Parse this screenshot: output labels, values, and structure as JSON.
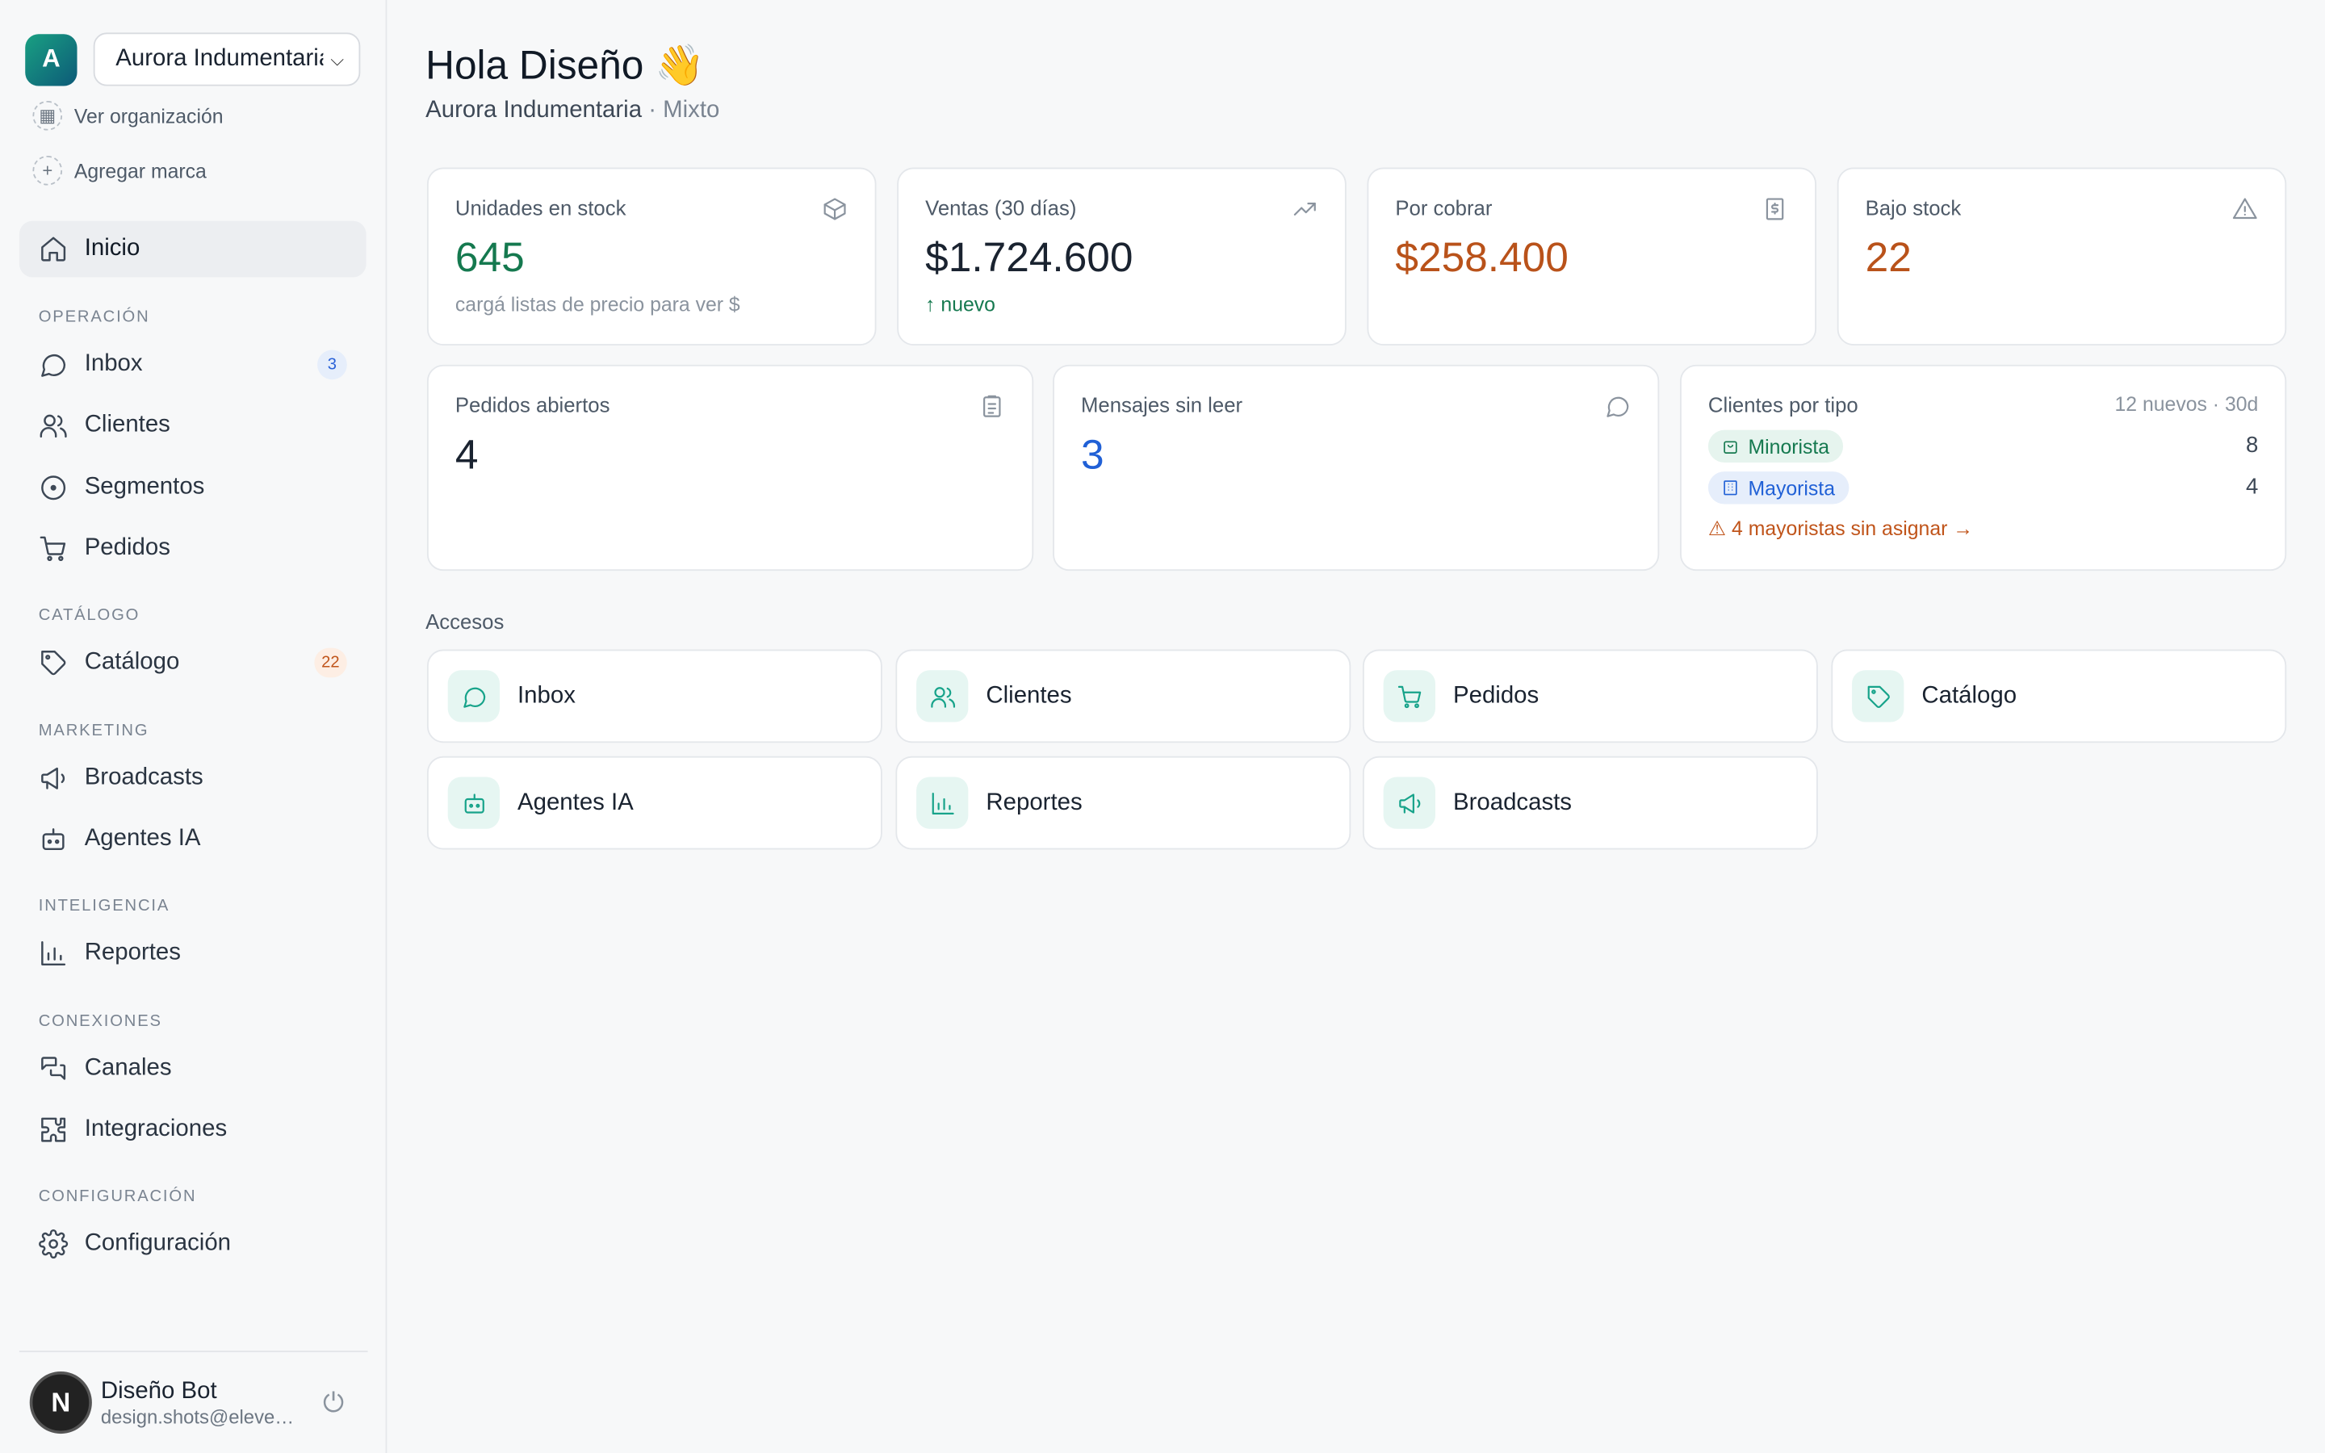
{
  "org": {
    "avatar_letter": "A",
    "selected": "Aurora Indumentaria",
    "view_org": "Ver organización",
    "add_brand": "Agregar marca"
  },
  "nav": {
    "home": "Inicio",
    "sections": {
      "operacion": "OPERACIÓN",
      "catalogo": "CATÁLOGO",
      "marketing": "MARKETING",
      "inteligencia": "INTELIGENCIA",
      "conexiones": "CONEXIONES",
      "configuracion": "CONFIGURACIÓN"
    },
    "inbox": "Inbox",
    "inbox_badge": "3",
    "clientes": "Clientes",
    "segmentos": "Segmentos",
    "pedidos": "Pedidos",
    "catalogo": "Catálogo",
    "catalogo_badge": "22",
    "broadcasts": "Broadcasts",
    "agentes": "Agentes IA",
    "reportes": "Reportes",
    "canales": "Canales",
    "integraciones": "Integraciones",
    "configuracion": "Configuración"
  },
  "user": {
    "avatar_letter": "N",
    "name": "Diseño Bot",
    "email": "design.shots@eleven.studio"
  },
  "header": {
    "greeting": "Hola Diseño 👋",
    "org_name": "Aurora Indumentaria",
    "org_type": "· Mixto"
  },
  "stats": {
    "stock": {
      "label": "Unidades en stock",
      "value": "645",
      "sub": "cargá listas de precio para ver $"
    },
    "ventas": {
      "label": "Ventas (30 días)",
      "value": "$1.724.600",
      "sub": "↑ nuevo"
    },
    "cobrar": {
      "label": "Por cobrar",
      "value": "$258.400"
    },
    "bajo": {
      "label": "Bajo stock",
      "value": "22"
    },
    "pedidos": {
      "label": "Pedidos abiertos",
      "value": "4"
    },
    "mensajes": {
      "label": "Mensajes sin leer",
      "value": "3"
    },
    "clientes": {
      "label": "Clientes por tipo",
      "meta": "12 nuevos · 30d",
      "minorista": "Minorista",
      "minorista_count": "8",
      "mayorista": "Mayorista",
      "mayorista_count": "4",
      "warning": "⚠ 4 mayoristas sin asignar →"
    }
  },
  "accesos": {
    "label": "Accesos",
    "inbox": "Inbox",
    "clientes": "Clientes",
    "pedidos": "Pedidos",
    "catalogo": "Catálogo",
    "agentes": "Agentes IA",
    "reportes": "Reportes",
    "broadcasts": "Broadcasts"
  },
  "colors": {
    "accent": "#17a38a",
    "green": "#15794f",
    "orange": "#b9521a",
    "blue": "#2060d6"
  }
}
